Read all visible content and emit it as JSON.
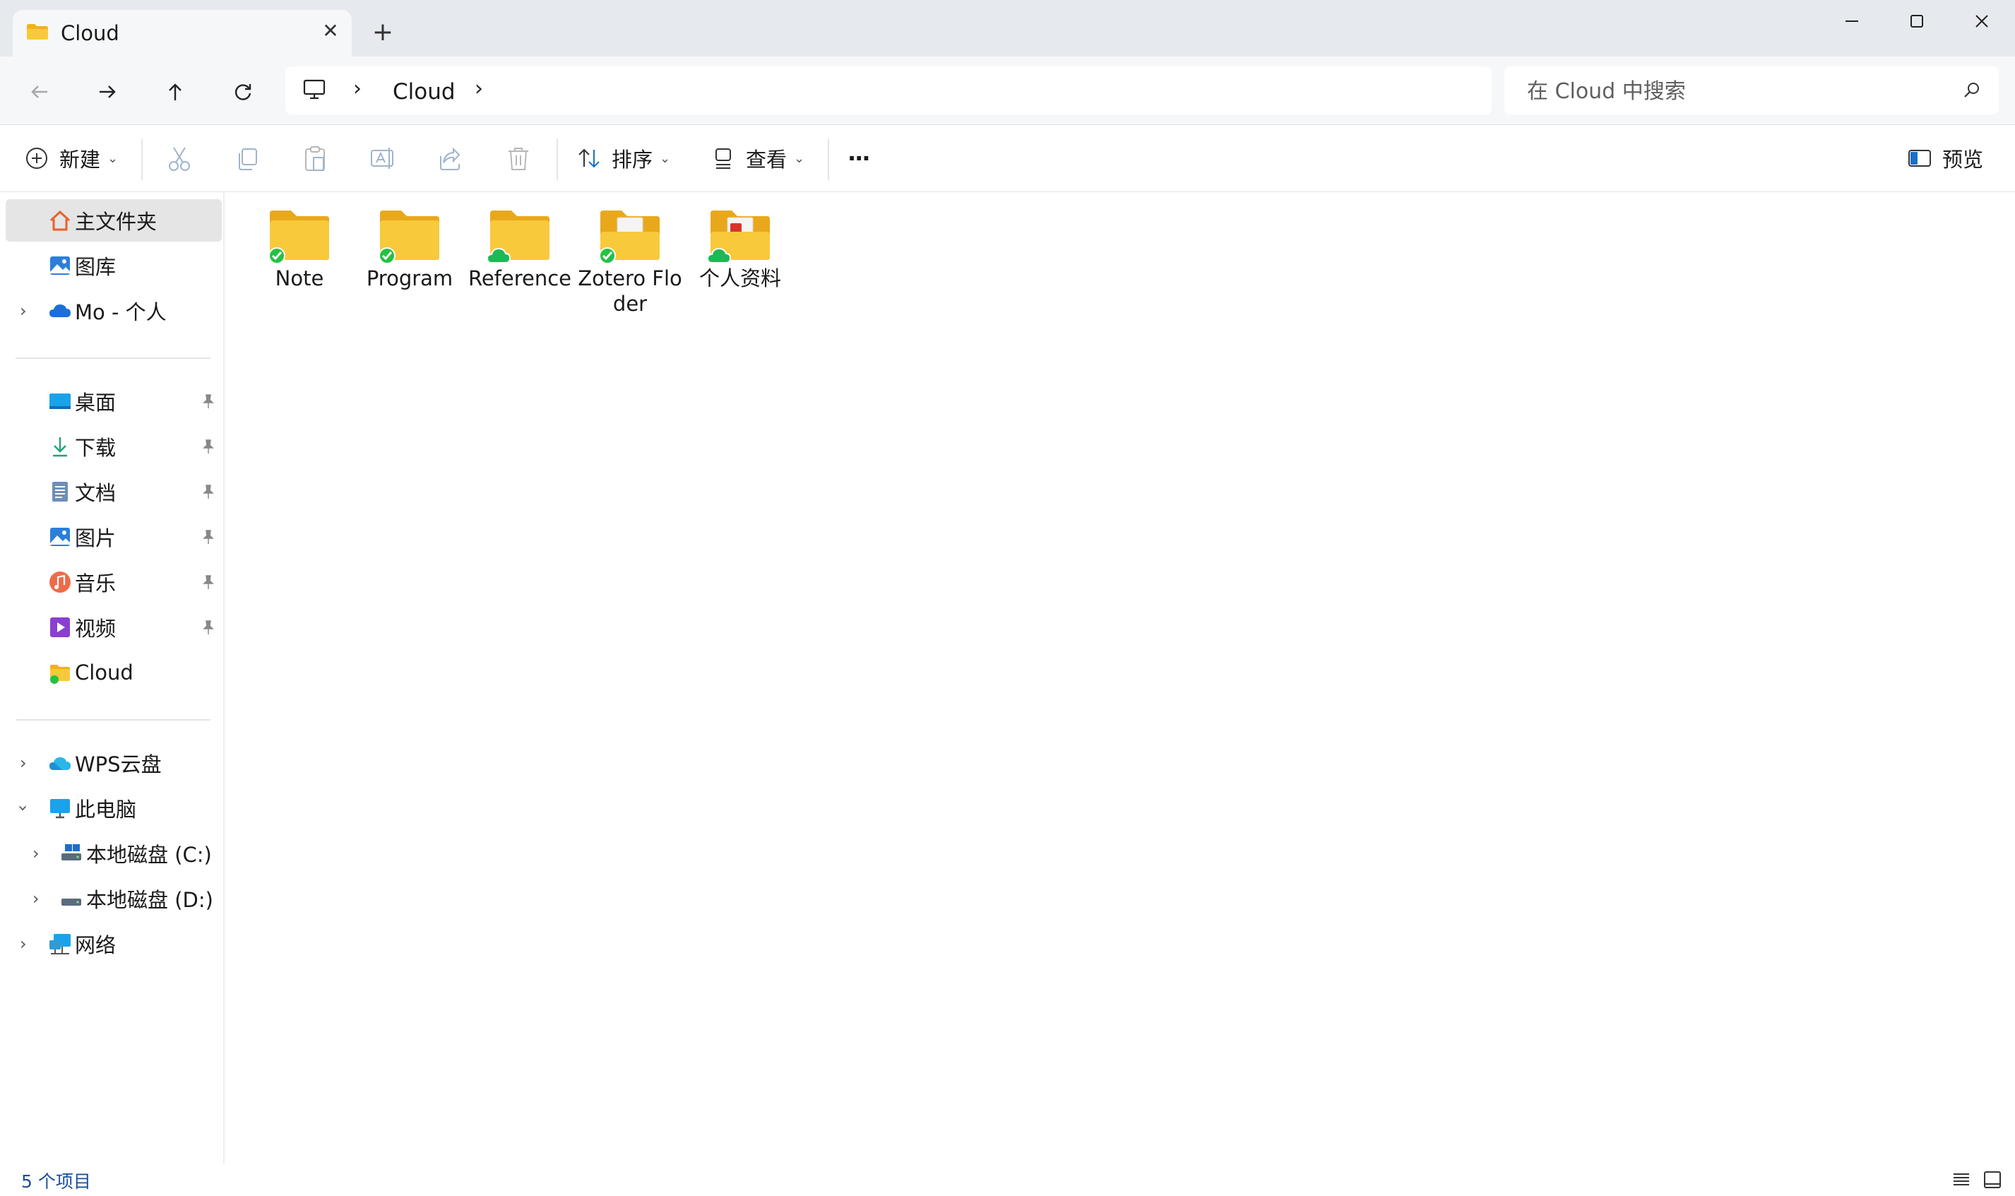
{
  "window": {
    "tab_title": "Cloud",
    "new_tab_symbol": "+",
    "close_tab_symbol": "✕",
    "minimize_symbol": "—",
    "maximize_symbol": "☐",
    "close_symbol": "✕"
  },
  "nav": {
    "breadcrumb": [
      "Cloud"
    ],
    "search_placeholder": "在 Cloud 中搜索"
  },
  "toolbar": {
    "new_label": "新建",
    "sort_label": "排序",
    "view_label": "查看",
    "more_label": "···",
    "preview_label": "预览",
    "icons": [
      "cut-icon",
      "copy-icon",
      "paste-icon",
      "rename-icon",
      "share-icon",
      "delete-icon"
    ]
  },
  "sidebar": {
    "home": "主文件夹",
    "gallery": "图库",
    "onedrive": "Mo - 个人",
    "pinned": [
      "桌面",
      "下载",
      "文档",
      "图片",
      "音乐",
      "视频"
    ],
    "cloud": "Cloud",
    "wps": "WPS云盘",
    "thispc": "此电脑",
    "drive_c": "本地磁盘 (C:)",
    "drive_d": "本地磁盘 (D:)",
    "network": "网络"
  },
  "files": [
    {
      "name": "Note",
      "status": "synced"
    },
    {
      "name": "Program",
      "status": "synced"
    },
    {
      "name": "Reference",
      "status": "cloud"
    },
    {
      "name": "Zotero Floder",
      "status": "synced"
    },
    {
      "name": "个人资料",
      "status": "cloud"
    }
  ],
  "status": {
    "item_count": "5 个项目"
  },
  "colors": {
    "folder": "#f8c93b",
    "folder_dark": "#e9a81b",
    "sync_green": "#26c142",
    "cloud_green": "#1db954",
    "accent": "#1a4f9c"
  }
}
